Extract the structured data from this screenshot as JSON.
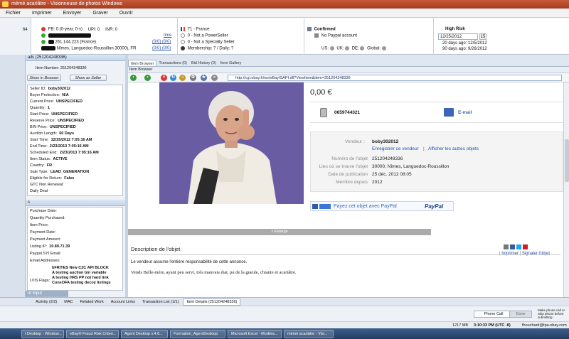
{
  "window": {
    "title": "mémé acariâtre - Visionneuse de photos Windows"
  },
  "menu": [
    "Fichier",
    "Imprimer",
    "Envoyer",
    "Graver",
    "Ouvrir"
  ],
  "infobar": {
    "num_label": "64",
    "fb": "FB: 0 (0-year, 0-s)",
    "upi": "UPI: 0",
    "inr": "INR: 0",
    "ip": "261.144.223 (France)",
    "address": "Nîmes, Languedoc-Roussillon 30000), FR",
    "time_label": "time",
    "counts_a": "(0/0) (0/0)",
    "counts_b": "(0/0) (0/0)",
    "country": "71 - France",
    "powerseller": "0 - Not a PowerSeller",
    "specialty": "0 - Not a Specialty Seller",
    "membership": "Membership: ? / Daily: ?",
    "confirmed": "Confirmed",
    "paypal_account": "No Paypal account",
    "regions": [
      "US:",
      "UK:",
      "DE:",
      "Global:"
    ],
    "risk_title": "High Risk",
    "risk_date": "12/25/2012",
    "risk_day_num": "15",
    "days_ago_1": "20 days ago: 12/5/2012",
    "days_ago_2": "90 days ago: 9/26/2012"
  },
  "left": {
    "header": "ails (251204248336)",
    "item_label": "Item Number:",
    "item_value": "251204248336",
    "btn_browser": "Show in Browser",
    "btn_seller": "Show as Seller",
    "fields": [
      {
        "k": "Seller ID:",
        "v": "boby302012"
      },
      {
        "k": "Buyer Protection:",
        "v": "N/A"
      },
      {
        "k": "Current Price:",
        "v": "UNSPECIFIED"
      },
      {
        "k": "Quantity:",
        "v": "1"
      },
      {
        "k": "Start Price:",
        "v": "UNSPECIFIED"
      },
      {
        "k": "Reserve Price:",
        "v": "UNSPECIFIED"
      },
      {
        "k": "BIN Price:",
        "v": "UNSPECIFIED"
      },
      {
        "k": "Auction Length:",
        "v": "60 Days"
      },
      {
        "k": "Start Time:",
        "v": "12/25/2012 7:05:16 AM"
      },
      {
        "k": "End Time:",
        "v": "2/23/2013 7:05:16 AM"
      },
      {
        "k": "Scheduled End:",
        "v": "2/23/2013 7:05:16 AM"
      },
      {
        "k": "Item Status:",
        "v": "ACTIVE"
      },
      {
        "k": "Country:",
        "v": "FR"
      },
      {
        "k": "Sale Type:",
        "v": "LEAD_GENERATION"
      },
      {
        "k": "Eligible for Return:",
        "v": "False"
      },
      {
        "k": "GTC Non Renewal:",
        "v": ""
      },
      {
        "k": "Daily Deal",
        "v": ""
      }
    ],
    "section2_header": "s",
    "fields2": [
      {
        "k": "Purchase Date:",
        "v": ""
      },
      {
        "k": "Quantity Purchased:",
        "v": ""
      },
      {
        "k": "Item Price:",
        "v": ""
      },
      {
        "k": "Payment Date:",
        "v": ""
      },
      {
        "k": "Payment Amount:",
        "v": ""
      },
      {
        "k": "Listing IP:",
        "v": "10.89.71.39"
      },
      {
        "k": "Paypal SYI Email:",
        "v": ""
      },
      {
        "k": "Email Addresses:",
        "v": ""
      }
    ],
    "flags_label": "LVIS Flags:",
    "flags": [
      "bFRITES New C2C API BLOCK",
      "A testing auction bin variable",
      "A testing HRS PP not hard link",
      "ConsOFA testing decoy listings"
    ],
    "bottom_tab": "ut Input"
  },
  "browser": {
    "tabs": [
      "Item Browser",
      "Transactions (0)",
      "Bid History (0)",
      "Item Gallery"
    ],
    "subhead": "Item Browser",
    "url": "http://cgi.ebay.fr/ws/eBayISAPI.dll?ViewItem&item=251204248336",
    "enlarge": "Enlarge",
    "price": "0,00 €",
    "phone": "0659744321",
    "email": "E-mail",
    "seller_label": "Vendeur :",
    "seller_name": "boby302012",
    "save_seller": "Enregistrer ce vendeur",
    "other_items": "Afficher les autres objets",
    "listing_rows": [
      {
        "k": "Numéro de l'objet",
        "v": "251204248336"
      },
      {
        "k": "Lieu où se trouve l'objet",
        "v": "30000, Nîmes, Languedoc-Roussillon"
      },
      {
        "k": "Date de publication",
        "v": "25 déc. 2012 08:05"
      },
      {
        "k": "Membre depuis",
        "v": "2012"
      }
    ],
    "paypal_text": "Payez cet objet avec PayPal",
    "paypal_logo": "PayPal",
    "desc_title": "Description de l'objet",
    "print": "Imprimer",
    "report": "Signaler l'objet",
    "desc_note": "Le vendeur assume l'entière responsabilité de cette annonce.",
    "desc_text": "Vends Belle-mère, ayant peu servi, très mauvais état, pu de la gueule, chiante et acariâtre."
  },
  "bottom_tabs": [
    "Activity (2/2)",
    "MAC",
    "Related Work",
    "Account Links",
    "Transaction List (1/1)",
    "Item Details (251204248336)"
  ],
  "callbar": {
    "phone_call": "Phone Call",
    "done": "Done",
    "note": "Make phone call or Skip phone before submitting"
  },
  "statusbar": {
    "mem": "1217 MB",
    "time": "3:10:33 PM (UTC -8)",
    "user": "fhouchard@tpa.ebay.com"
  },
  "taskbar": [
    "t Desktop - Window...",
    "eBay® Fraud Risk Criteri...",
    "Agent Desktop v.4.6...",
    "Formation_AgentDesktop",
    "Microsoft Excel - Modèra...",
    "mémé acariâtre - Visi..."
  ],
  "colors": {
    "accent": "#2050b0",
    "title": "#a83a1e",
    "paypal": "#3b66b8"
  }
}
